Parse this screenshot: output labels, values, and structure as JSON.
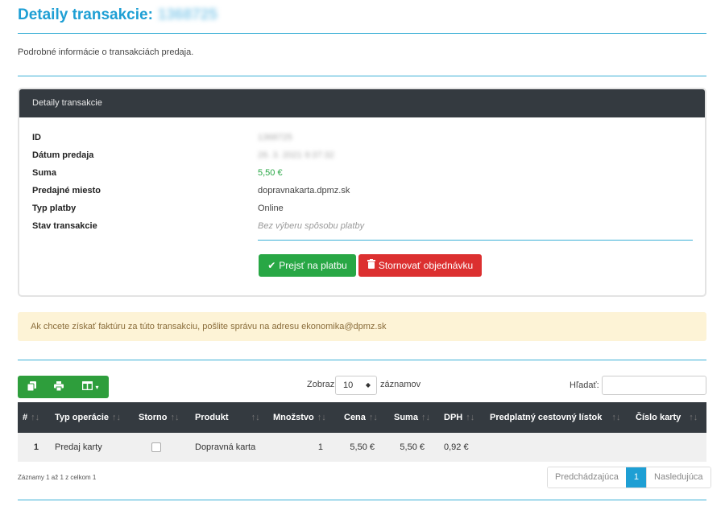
{
  "header": {
    "title": "Detaily transakcie:",
    "title_id": "1368725",
    "subtitle": "Podrobné informácie o transakciách predaja."
  },
  "card": {
    "title": "Detaily transakcie",
    "rows": [
      {
        "label": "ID",
        "value": "1368725"
      },
      {
        "label": "Dátum predaja",
        "value": "26. 3. 2021 9:37:32"
      },
      {
        "label": "Suma",
        "value": "5,50 €"
      },
      {
        "label": "Predajné miesto",
        "value": "dopravnakarta.dpmz.sk"
      },
      {
        "label": "Typ platby",
        "value": "Online"
      },
      {
        "label": "Stav transakcie",
        "value": "Bez výberu spôsobu platby"
      }
    ],
    "pay_button": "Prejsť na platbu",
    "cancel_button": "Stornovať objednávku"
  },
  "alert": {
    "text": "Ak chcete získať faktúru za túto transakciu, pošlite správu na adresu ekonomika@dpmz.sk"
  },
  "table_controls": {
    "show_label": "Zobraz",
    "page_size": "10",
    "records_label": "záznamov",
    "search_label": "Hľadať:"
  },
  "table": {
    "columns": [
      "#",
      "Typ operácie",
      "Storno",
      "Produkt",
      "Množstvo",
      "Cena",
      "Suma",
      "DPH",
      "Predplatný cestovný lístok",
      "Číslo karty"
    ],
    "rows": [
      {
        "index": "1",
        "operation": "Predaj karty",
        "product": "Dopravná karta",
        "quantity": "1",
        "price": "5,50 €",
        "sum": "5,50 €",
        "vat": "0,92 €",
        "ticket": "",
        "card_no": ""
      }
    ]
  },
  "footer": {
    "info": "Záznamy 1 až 1 z celkom 1",
    "prev": "Predchádzajúca",
    "current_page": "1",
    "next": "Nasledujúca"
  },
  "colors": {
    "accent": "#1e9fd4",
    "success": "#28a745",
    "danger": "#dc3030",
    "dark": "#343a40",
    "alert_bg": "#fdf3d6"
  }
}
